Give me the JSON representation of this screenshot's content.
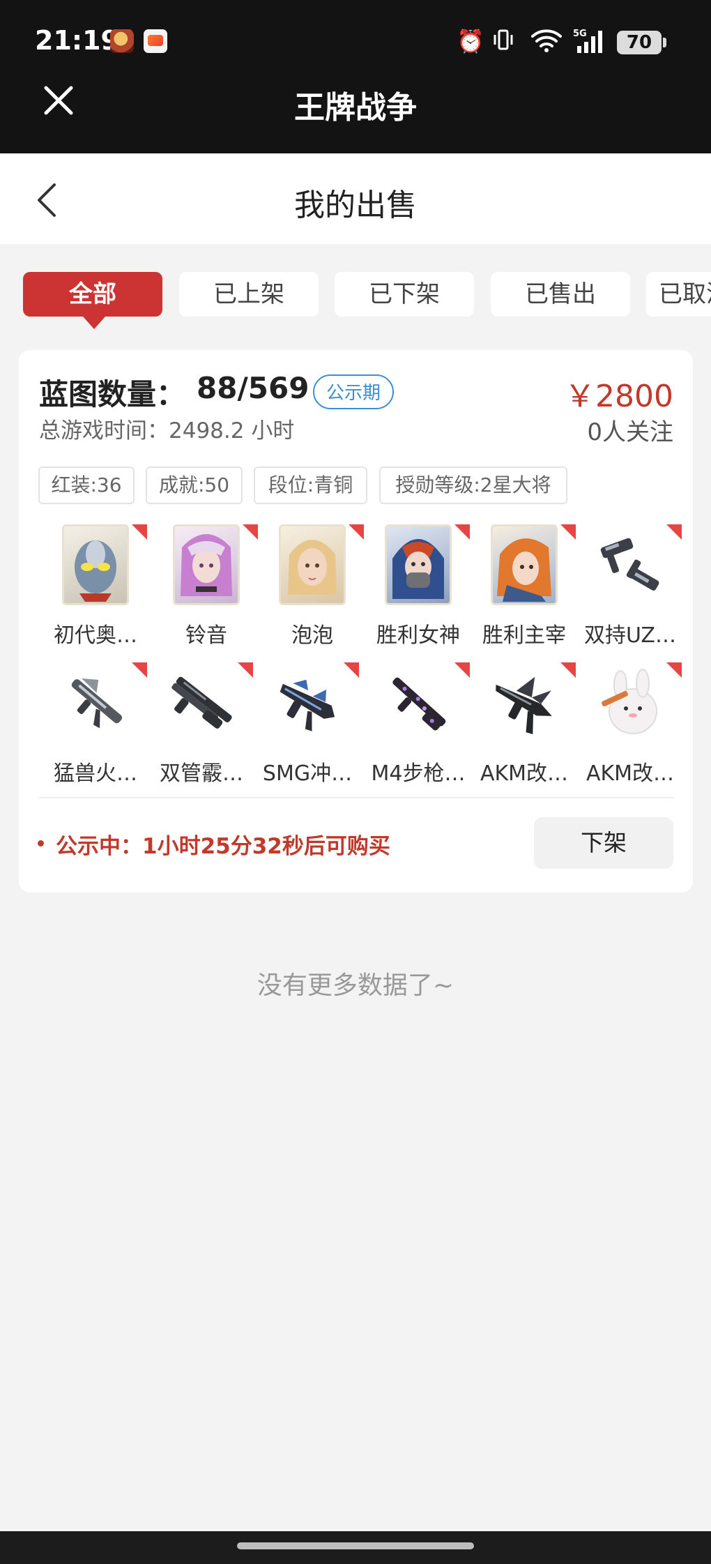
{
  "status_bar": {
    "time": "21:19",
    "battery": "70",
    "network": "5G"
  },
  "app": {
    "title": "王牌战争"
  },
  "page": {
    "title": "我的出售"
  },
  "tabs": [
    {
      "label": "全部",
      "active": true
    },
    {
      "label": "已上架",
      "active": false
    },
    {
      "label": "已下架",
      "active": false
    },
    {
      "label": "已售出",
      "active": false
    },
    {
      "label": "已取消",
      "active": false
    }
  ],
  "listing": {
    "blueprint_label": "蓝图数量：",
    "blueprint_value": "88/569",
    "badge": "公示期",
    "price": "￥2800",
    "play_time": "总游戏时间：2498.2 小时",
    "followers": "0人关注",
    "tags": [
      "红装:36",
      "成就:50",
      "段位:青铜",
      "授勋等级:2星大将"
    ],
    "items": [
      {
        "name": "初代奥…",
        "icon": "ultraman-skin-icon"
      },
      {
        "name": "铃音",
        "icon": "character-pink-icon"
      },
      {
        "name": "泡泡",
        "icon": "character-blonde-icon"
      },
      {
        "name": "胜利女神",
        "icon": "character-mask-icon"
      },
      {
        "name": "胜利主宰",
        "icon": "character-orange-icon"
      },
      {
        "name": "双持UZ…",
        "icon": "dual-uzi-icon"
      },
      {
        "name": "猛兽火…",
        "icon": "flamethrower-icon"
      },
      {
        "name": "双管霰…",
        "icon": "double-shotgun-icon"
      },
      {
        "name": "SMG冲…",
        "icon": "smg-icon"
      },
      {
        "name": "M4步枪…",
        "icon": "m4-rifle-icon"
      },
      {
        "name": "AKM改…",
        "icon": "akm-dragon-icon"
      },
      {
        "name": "AKM改…",
        "icon": "akm-bunny-icon"
      }
    ],
    "status": "公示中：1小时25分32秒后可购买",
    "delist_button": "下架"
  },
  "footer": {
    "no_more": "没有更多数据了~"
  },
  "colors": {
    "accent": "#cc3333",
    "price": "#c0392b",
    "badge": "#3b8fd0",
    "top_bar": "#131313"
  }
}
